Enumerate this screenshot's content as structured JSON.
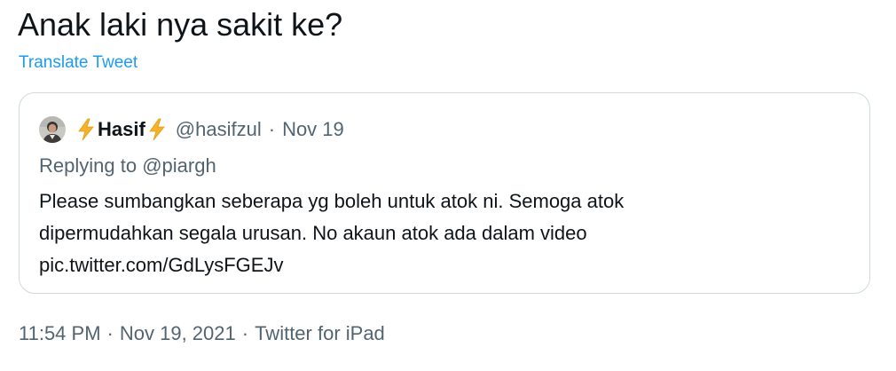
{
  "tweet": {
    "text": "Anak laki nya sakit ke?",
    "translate_label": "Translate Tweet"
  },
  "quoted_tweet": {
    "display_name": "Hasif",
    "handle": "@hasifzul",
    "separator": "·",
    "date": "Nov 19",
    "replying_prefix": "Replying to ",
    "replying_to": "@piargh",
    "body_lines": [
      "Please sumbangkan seberapa yg boleh untuk atok ni. Semoga atok",
      "dipermudahkan segala urusan. No akaun atok ada dalam video",
      "pic.twitter.com/GdLysFGEJv"
    ],
    "icons": {
      "avatar": "user-avatar",
      "name_prefix": "lightning-bolt-icon",
      "name_suffix": "lightning-bolt-icon"
    }
  },
  "meta": {
    "time": "11:54 PM",
    "separator": "·",
    "date": "Nov 19, 2021",
    "source": "Twitter for iPad"
  },
  "colors": {
    "link": "#1d9bf0",
    "text": "#0f1419",
    "secondary": "#536471",
    "border": "#cfd9de",
    "bolt": "#f7b22b"
  }
}
